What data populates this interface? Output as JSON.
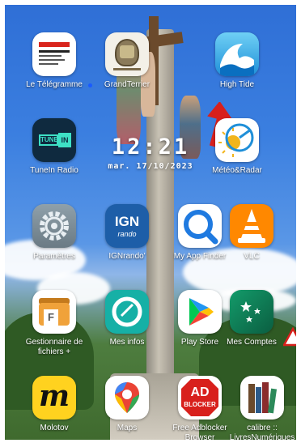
{
  "clock": {
    "time": "12:21",
    "date": "mar. 17/10/2023"
  },
  "apps": [
    {
      "name": "le-telegramme",
      "label": "Le Télégramme",
      "icon": "newspaper-icon",
      "badge_top": "Le Télégramme",
      "badge_text": "LA MEILLEURE DE BRETAGNE",
      "color": "#ffffff"
    },
    {
      "name": "grandterrier",
      "label": "GrandTerrier",
      "icon": "grandterrier-logo-icon",
      "new": true,
      "color": "#f3f0e8"
    },
    {
      "name": "high-tide",
      "label": "High Tide",
      "icon": "wave-icon",
      "color": "#3aa8e6"
    },
    {
      "name": "tunein-radio",
      "label": "TuneIn Radio",
      "icon": "tunein-icon",
      "logo_text": "TUNE IN",
      "color": "#0f2a3f"
    },
    {
      "name": "meteo-radar",
      "label": "Météo&Radar",
      "icon": "sun-radar-icon",
      "color": "#ffffff"
    },
    {
      "name": "parametres",
      "label": "Paramètres",
      "icon": "gear-icon",
      "color": "#7a8a94"
    },
    {
      "name": "ignrando",
      "label": "IGNrando'",
      "icon": "ign-icon",
      "logo_text": "IGN",
      "sub_text": "rando",
      "color": "#1d5ea8"
    },
    {
      "name": "my-app-finder",
      "label": "My App Finder",
      "icon": "magnifier-icon",
      "color": "#ffffff"
    },
    {
      "name": "vlc",
      "label": "VLC",
      "icon": "traffic-cone-icon",
      "color": "#ff8800"
    },
    {
      "name": "gestionnaire-fichiers",
      "label": "Gestionnaire de fichiers +",
      "icon": "folder-icon",
      "color": "#ffffff"
    },
    {
      "name": "mes-infos",
      "label": "Mes infos",
      "icon": "mes-infos-icon",
      "color": "#16b0a6"
    },
    {
      "name": "play-store",
      "label": "Play Store",
      "icon": "play-triangle-icon",
      "color": "#ffffff"
    },
    {
      "name": "mes-comptes",
      "label": "Mes Comptes",
      "icon": "bnp-stars-icon",
      "color": "#0f7a55"
    },
    {
      "name": "molotov",
      "label": "Molotov",
      "icon": "molotov-m-icon",
      "logo_text": "m",
      "color": "#ffd21f"
    },
    {
      "name": "maps",
      "label": "Maps",
      "icon": "map-pin-icon",
      "color": "#ffffff"
    },
    {
      "name": "free-adblocker",
      "label": "Free Adblocker Browser",
      "icon": "ad-blocker-icon",
      "logo_text": "AD",
      "sub_text": "BLOCKER",
      "color": "#ffffff"
    },
    {
      "name": "calibre",
      "label": "calibre :: LivresNumériques",
      "icon": "books-icon",
      "color": "#ffffff"
    }
  ]
}
